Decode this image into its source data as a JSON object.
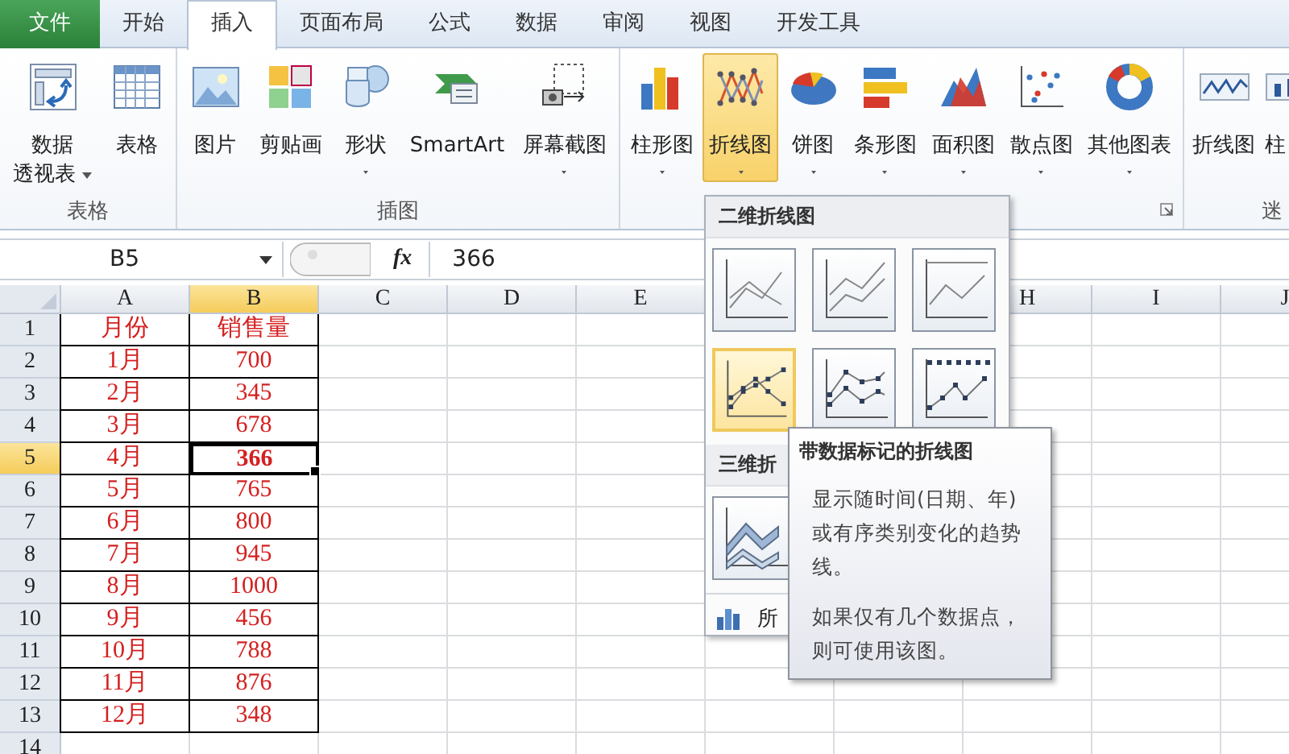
{
  "tabs": [
    {
      "label": "文件",
      "kind": "file",
      "selected": false
    },
    {
      "label": "开始",
      "kind": "tab",
      "selected": false
    },
    {
      "label": "插入",
      "kind": "tab",
      "selected": true
    },
    {
      "label": "页面布局",
      "kind": "tab",
      "selected": false
    },
    {
      "label": "公式",
      "kind": "tab",
      "selected": false
    },
    {
      "label": "数据",
      "kind": "tab",
      "selected": false
    },
    {
      "label": "审阅",
      "kind": "tab",
      "selected": false
    },
    {
      "label": "视图",
      "kind": "tab",
      "selected": false
    },
    {
      "label": "开发工具",
      "kind": "tab",
      "selected": false
    }
  ],
  "ribbon": {
    "groups": [
      {
        "label": "表格",
        "launcher": false,
        "buttons": [
          {
            "lines": [
              "数据",
              "透视表"
            ],
            "dropdown": true,
            "pressed": false
          },
          {
            "label": "表格",
            "dropdown": false,
            "pressed": false
          }
        ]
      },
      {
        "label": "插图",
        "launcher": false,
        "buttons": [
          {
            "label": "图片",
            "dropdown": false,
            "pressed": false
          },
          {
            "label": "剪贴画",
            "dropdown": false,
            "pressed": false
          },
          {
            "label": "形状",
            "dropdown": true,
            "pressed": false
          },
          {
            "label": "SmartArt",
            "dropdown": false,
            "pressed": false
          },
          {
            "label": "屏幕截图",
            "dropdown": true,
            "pressed": false
          }
        ]
      },
      {
        "launcher": true,
        "buttons": [
          {
            "label": "柱形图",
            "dropdown": true,
            "pressed": false
          },
          {
            "label": "折线图",
            "dropdown": true,
            "pressed": true
          },
          {
            "label": "饼图",
            "dropdown": true,
            "pressed": false
          },
          {
            "label": "条形图",
            "dropdown": true,
            "pressed": false
          },
          {
            "label": "面积图",
            "dropdown": true,
            "pressed": false
          },
          {
            "label": "散点图",
            "dropdown": true,
            "pressed": false
          },
          {
            "label": "其他图表",
            "dropdown": true,
            "pressed": false
          }
        ]
      },
      {
        "label": "迷",
        "launcher": false,
        "buttons": [
          {
            "label": "折线图",
            "pressed": false
          },
          {
            "label": "柱",
            "pressed": false
          }
        ]
      }
    ]
  },
  "formula_bar": {
    "name_box": "B5",
    "function_label": "fx",
    "formula": "366"
  },
  "sheet": {
    "columns": [
      {
        "label": "A",
        "selected": false
      },
      {
        "label": "B",
        "selected": true
      },
      {
        "label": "C",
        "selected": false
      },
      {
        "label": "D",
        "selected": false
      },
      {
        "label": "E",
        "selected": false
      },
      {
        "label": "H",
        "selected": false
      },
      {
        "label": "I",
        "selected": false
      },
      {
        "label": "J",
        "selected": false
      }
    ],
    "rows": [
      {
        "label": "1",
        "selected": false,
        "cells": [
          {
            "text": "月份",
            "selected": false
          },
          {
            "text": "销售量",
            "selected": false
          }
        ]
      },
      {
        "label": "2",
        "selected": false,
        "cells": [
          {
            "text": "1月",
            "selected": false
          },
          {
            "text": "700",
            "selected": false
          }
        ]
      },
      {
        "label": "3",
        "selected": false,
        "cells": [
          {
            "text": "2月",
            "selected": false
          },
          {
            "text": "345",
            "selected": false
          }
        ]
      },
      {
        "label": "4",
        "selected": false,
        "cells": [
          {
            "text": "3月",
            "selected": false
          },
          {
            "text": "678",
            "selected": false
          }
        ]
      },
      {
        "label": "5",
        "selected": true,
        "cells": [
          {
            "text": "4月",
            "selected": false
          },
          {
            "text": "366",
            "selected": true
          }
        ]
      },
      {
        "label": "6",
        "selected": false,
        "cells": [
          {
            "text": "5月",
            "selected": false
          },
          {
            "text": "765",
            "selected": false
          }
        ]
      },
      {
        "label": "7",
        "selected": false,
        "cells": [
          {
            "text": "6月",
            "selected": false
          },
          {
            "text": "800",
            "selected": false
          }
        ]
      },
      {
        "label": "8",
        "selected": false,
        "cells": [
          {
            "text": "7月",
            "selected": false
          },
          {
            "text": "945",
            "selected": false
          }
        ]
      },
      {
        "label": "9",
        "selected": false,
        "cells": [
          {
            "text": "8月",
            "selected": false
          },
          {
            "text": "1000",
            "selected": false
          }
        ]
      },
      {
        "label": "10",
        "selected": false,
        "cells": [
          {
            "text": "9月",
            "selected": false
          },
          {
            "text": "456",
            "selected": false
          }
        ]
      },
      {
        "label": "11",
        "selected": false,
        "cells": [
          {
            "text": "10月",
            "selected": false
          },
          {
            "text": "788",
            "selected": false
          }
        ]
      },
      {
        "label": "12",
        "selected": false,
        "cells": [
          {
            "text": "11月",
            "selected": false
          },
          {
            "text": "876",
            "selected": false
          }
        ]
      },
      {
        "label": "13",
        "selected": false,
        "cells": [
          {
            "text": "12月",
            "selected": false
          },
          {
            "text": "348",
            "selected": false
          }
        ]
      },
      {
        "label": "14",
        "selected": false,
        "cells": []
      }
    ]
  },
  "gallery": {
    "header": "二维折线图",
    "thumbnails": [
      {
        "selected": false
      },
      {
        "selected": false
      },
      {
        "selected": false
      },
      {
        "selected": true
      },
      {
        "selected": false
      },
      {
        "selected": false
      }
    ],
    "section_3d": "三维折",
    "thumbnails_3d": [
      {
        "selected": false
      }
    ],
    "footer": "所"
  },
  "tooltip": {
    "title": "带数据标记的折线图",
    "paragraphs": [
      "显示随时间(日期、年)或有序类别变化的趋势线。",
      "如果仅有几个数据点，则可使用该图。"
    ]
  }
}
